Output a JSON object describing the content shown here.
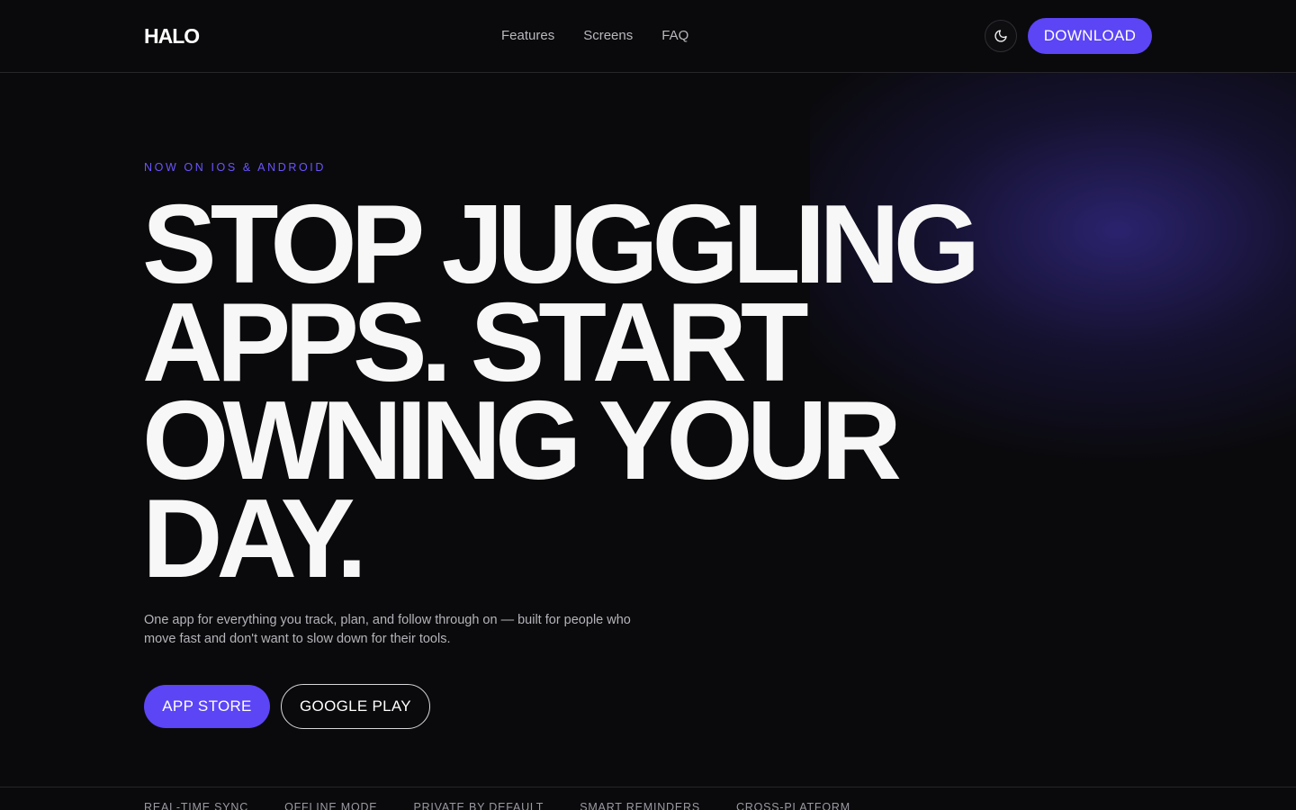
{
  "header": {
    "logo": "HALO",
    "nav": [
      {
        "label": "Features"
      },
      {
        "label": "Screens"
      },
      {
        "label": "FAQ"
      }
    ],
    "download_label": "DOWNLOAD",
    "theme_icon": "moon-icon"
  },
  "hero": {
    "eyebrow": "NOW ON IOS & ANDROID",
    "headline_lines": [
      "STOP JUGGLING",
      "APPS. START",
      "OWNING YOUR",
      "DAY."
    ],
    "subtitle": "One app for everything you track, plan, and follow through on — built for people who move fast and don't want to slow down for their tools.",
    "app_store_label": "APP STORE",
    "google_play_label": "GOOGLE PLAY"
  },
  "features_strip": [
    "REAL-TIME SYNC",
    "OFFLINE MODE",
    "PRIVATE BY DEFAULT",
    "SMART REMINDERS",
    "CROSS-PLATFORM"
  ],
  "colors": {
    "background": "#0a0a0c",
    "accent": "#5b45f5",
    "eyebrow": "#6a55ff",
    "text": "#f7f7f7",
    "muted": "#b4b4ba"
  }
}
